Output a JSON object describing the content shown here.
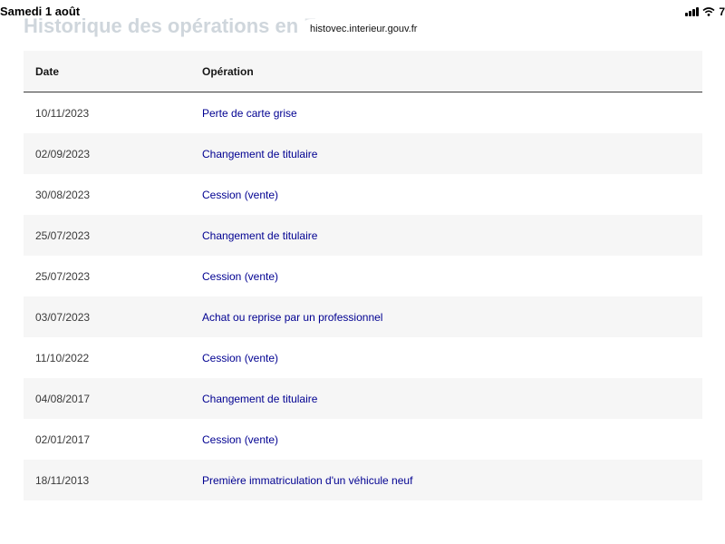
{
  "status_bar": {
    "date": "Samedi 1 août",
    "battery": "7"
  },
  "page": {
    "heading": "Historique des opérations en France",
    "url": "histovec.interieur.gouv.fr"
  },
  "table": {
    "headers": {
      "date": "Date",
      "operation": "Opération"
    },
    "rows": [
      {
        "date": "10/11/2023",
        "operation": "Perte de carte grise"
      },
      {
        "date": "02/09/2023",
        "operation": "Changement de titulaire"
      },
      {
        "date": "30/08/2023",
        "operation": "Cession (vente)"
      },
      {
        "date": "25/07/2023",
        "operation": "Changement de titulaire"
      },
      {
        "date": "25/07/2023",
        "operation": "Cession (vente)"
      },
      {
        "date": "03/07/2023",
        "operation": "Achat ou reprise par un professionnel"
      },
      {
        "date": "11/10/2022",
        "operation": "Cession (vente)"
      },
      {
        "date": "04/08/2017",
        "operation": "Changement de titulaire"
      },
      {
        "date": "02/01/2017",
        "operation": "Cession (vente)"
      },
      {
        "date": "18/11/2013",
        "operation": "Première immatriculation d'un véhicule neuf"
      }
    ]
  },
  "colors": {
    "link": "#000091",
    "stripe": "#f6f6f6",
    "header_border": "#3a3a3a"
  }
}
